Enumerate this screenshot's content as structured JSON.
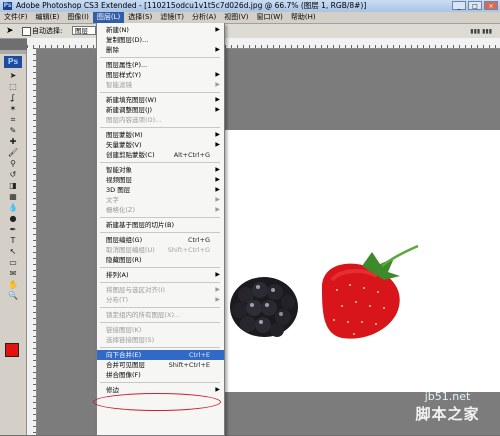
{
  "titlebar": {
    "title": "Adobe Photoshop CS3 Extended - [110215odcu1v1t5c7d026d.jpg @ 66.7% (图层 1, RGB/8#)]",
    "logo": "Ps",
    "buttons": [
      "_",
      "□",
      "×"
    ]
  },
  "menubar": {
    "items": [
      {
        "label": "文件(F)"
      },
      {
        "label": "编辑(E)"
      },
      {
        "label": "图像(I)"
      },
      {
        "label": "图层(L)"
      },
      {
        "label": "选择(S)"
      },
      {
        "label": "滤镜(T)"
      },
      {
        "label": "分析(A)"
      },
      {
        "label": "视图(V)"
      },
      {
        "label": "窗口(W)"
      },
      {
        "label": "帮助(H)"
      }
    ],
    "active": "图层(L)"
  },
  "options": {
    "auto_select_label": "自动选择:",
    "auto_select_value": "图层"
  },
  "toolbox": {
    "logo": "Ps",
    "tools": [
      "move-tool",
      "marquee-tool",
      "lasso-tool",
      "magic-wand-tool",
      "crop-tool",
      "eyedropper-tool",
      "healing-tool",
      "brush-tool",
      "stamp-tool",
      "history-brush-tool",
      "eraser-tool",
      "gradient-tool",
      "blur-tool",
      "dodge-tool",
      "pen-tool",
      "type-tool",
      "path-select-tool",
      "shape-tool",
      "notes-tool",
      "hand-tool",
      "zoom-tool"
    ],
    "foreground_color": "#e3120f",
    "background_color": "#ffffff"
  },
  "menu": {
    "items": [
      {
        "label": "新建(N)",
        "submenu": true
      },
      {
        "label": "复制图层(D)..."
      },
      {
        "label": "删除",
        "submenu": true
      },
      {
        "sep": true
      },
      {
        "label": "图层属性(P)..."
      },
      {
        "label": "图层样式(Y)",
        "submenu": true
      },
      {
        "label": "智能滤镜",
        "disabled": true,
        "submenu": true
      },
      {
        "sep": true
      },
      {
        "label": "新建填充图层(W)",
        "submenu": true
      },
      {
        "label": "新建调整图层(J)",
        "submenu": true
      },
      {
        "label": "图层内容选项(O)...",
        "disabled": true
      },
      {
        "sep": true
      },
      {
        "label": "图层蒙版(M)",
        "submenu": true
      },
      {
        "label": "矢量蒙版(V)",
        "submenu": true
      },
      {
        "label": "创建剪贴蒙版(C)",
        "shortcut": "Alt+Ctrl+G"
      },
      {
        "sep": true
      },
      {
        "label": "智能对象",
        "submenu": true
      },
      {
        "label": "视频图层",
        "submenu": true
      },
      {
        "label": "3D 图层",
        "submenu": true
      },
      {
        "label": "文字",
        "disabled": true,
        "submenu": true
      },
      {
        "label": "栅格化(Z)",
        "disabled": true,
        "submenu": true
      },
      {
        "sep": true
      },
      {
        "label": "新建基于图层的切片(B)"
      },
      {
        "sep": true
      },
      {
        "label": "图层编组(G)",
        "shortcut": "Ctrl+G"
      },
      {
        "label": "取消图层编组(U)",
        "shortcut": "Shift+Ctrl+G",
        "disabled": true
      },
      {
        "label": "隐藏图层(R)"
      },
      {
        "sep": true
      },
      {
        "label": "排列(A)",
        "submenu": true
      },
      {
        "sep": true
      },
      {
        "label": "将图层与选区对齐(I)",
        "disabled": true,
        "submenu": true
      },
      {
        "label": "分布(T)",
        "disabled": true,
        "submenu": true
      },
      {
        "sep": true
      },
      {
        "label": "锁定组内的所有图层(X)...",
        "disabled": true
      },
      {
        "sep": true
      },
      {
        "label": "链接图层(K)",
        "disabled": true
      },
      {
        "label": "选择链接图层(S)",
        "disabled": true
      },
      {
        "sep": true
      },
      {
        "label": "向下合并(E)",
        "shortcut": "Ctrl+E",
        "highlighted": true
      },
      {
        "label": "合并可见图层",
        "shortcut": "Shift+Ctrl+E"
      },
      {
        "label": "拼合图像(F)"
      },
      {
        "sep": true
      },
      {
        "label": "修边",
        "submenu": true
      }
    ]
  },
  "canvas": {
    "background": "#ffffff",
    "objects": [
      "blackberry",
      "strawberry"
    ]
  },
  "watermark": {
    "line1": "jb51.net",
    "line2": "脚本之家"
  }
}
